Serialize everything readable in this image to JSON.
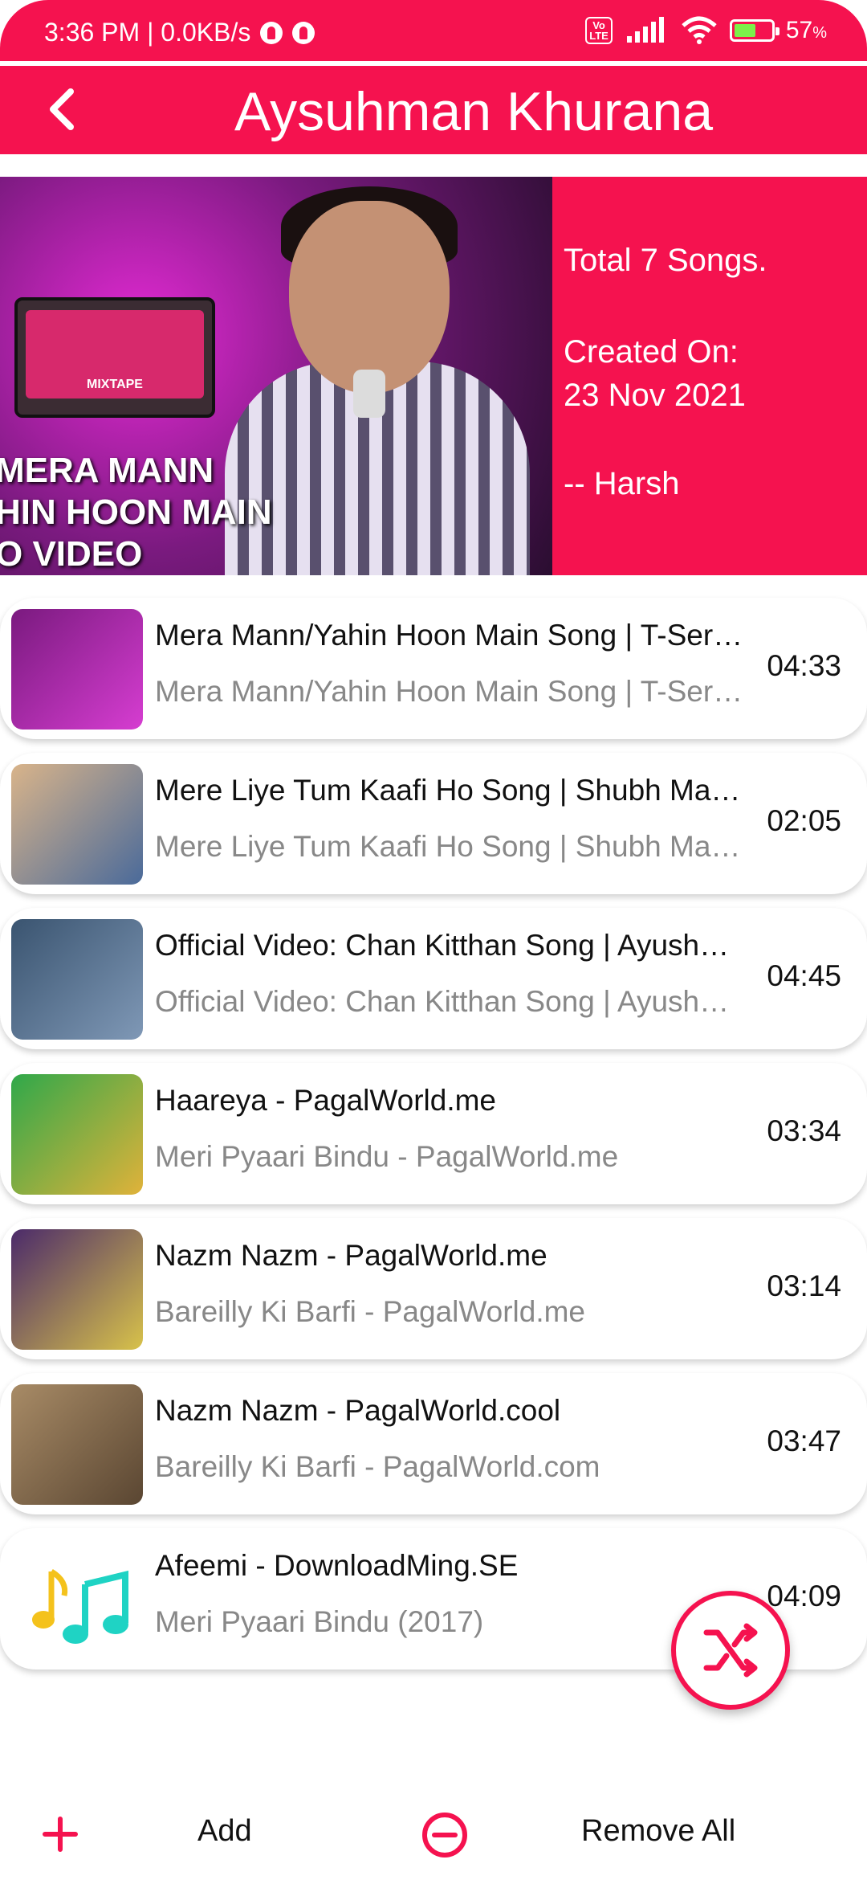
{
  "status_bar": {
    "time": "3:36 PM | 0.0KB/s",
    "battery": "57",
    "battery_unit": "%",
    "volte": "Vo LTE"
  },
  "header": {
    "title": "Aysuhman Khurana"
  },
  "playlist_info": {
    "total_songs": "Total 7 Songs.",
    "created_label": "Created On:",
    "created_date": "23 Nov 2021",
    "author": "-- Harsh"
  },
  "hero_art": {
    "cassette_label": "MIXTAPE",
    "text_line1": "MERA MANN",
    "text_line2": "HIN HOON MAIN",
    "text_line3": "O VIDEO"
  },
  "songs": [
    {
      "title": "Mera Mann/Yahin Hoon Main Song | T-Series Mixtape Punjabi | Ayushmann",
      "subtitle": "Mera Mann/Yahin Hoon Main Song | T-Series Mixtape Punjabi | Ayushmann",
      "duration": "04:33",
      "thumb": "#7a1a7f",
      "thumb2": "#d63dd1"
    },
    {
      "title": "Mere Liye Tum Kaafi Ho Song | Shubh Mangal Zyada Saavdhan",
      "subtitle": "Mere Liye Tum Kaafi Ho Song | Shubh Mangal Zyada Saavdhan",
      "duration": "02:05",
      "thumb": "#d9b48a",
      "thumb2": "#4a6a9a"
    },
    {
      "title": "Official Video: Chan Kitthan Song | Ayushmann Khurrana",
      "subtitle": "Official Video: Chan Kitthan Song | Ayushmann Khurrana",
      "duration": "04:45",
      "thumb": "#3a5470",
      "thumb2": "#7f98b6"
    },
    {
      "title": "Haareya - PagalWorld.me",
      "subtitle": "Meri Pyaari Bindu - PagalWorld.me",
      "duration": "03:34",
      "thumb": "#2fa84a",
      "thumb2": "#e0b23a"
    },
    {
      "title": "Nazm Nazm - PagalWorld.me",
      "subtitle": "Bareilly Ki Barfi - PagalWorld.me",
      "duration": "03:14",
      "thumb": "#4b2a6a",
      "thumb2": "#d8c24a"
    },
    {
      "title": "Nazm Nazm - PagalWorld.cool",
      "subtitle": "Bareilly Ki Barfi - PagalWorld.com",
      "duration": "03:47",
      "thumb": "#a88b66",
      "thumb2": "#5a4632"
    },
    {
      "title": "Afeemi -  DownloadMing.SE",
      "subtitle": "Meri Pyaari Bindu (2017)",
      "duration": "04:09",
      "thumb": "music-note-icon",
      "thumb2": ""
    }
  ],
  "bottom_bar": {
    "add_label": "Add",
    "remove_label": "Remove All"
  },
  "colors": {
    "accent": "#f5124f"
  }
}
